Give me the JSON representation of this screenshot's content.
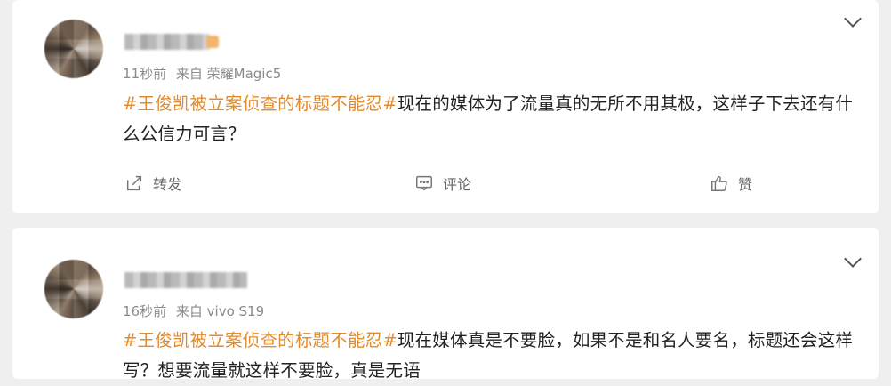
{
  "posts": [
    {
      "time": "11秒前",
      "source": "来自 荣耀Magic5",
      "hashtag": "#王俊凯被立案侦查的标题不能忍#",
      "text": "现在的媒体为了流量真的无所不用其极，这样子下去还有什么公信力可言？",
      "actions": {
        "forward": "转发",
        "comment": "评论",
        "like": "赞"
      }
    },
    {
      "time": "16秒前",
      "source": "来自 vivo S19",
      "hashtag": "#王俊凯被立案侦查的标题不能忍#",
      "text": "现在媒体真是不要脸，如果不是和名人要名，标题还会这样写？想要流量就这样不要脸，真是无语"
    }
  ],
  "colors": {
    "hashtag": "#e08b2f",
    "background": "#efefef",
    "card": "#ffffff"
  },
  "icons": [
    "chevron-down-icon",
    "forward-icon",
    "comment-icon",
    "like-icon"
  ]
}
